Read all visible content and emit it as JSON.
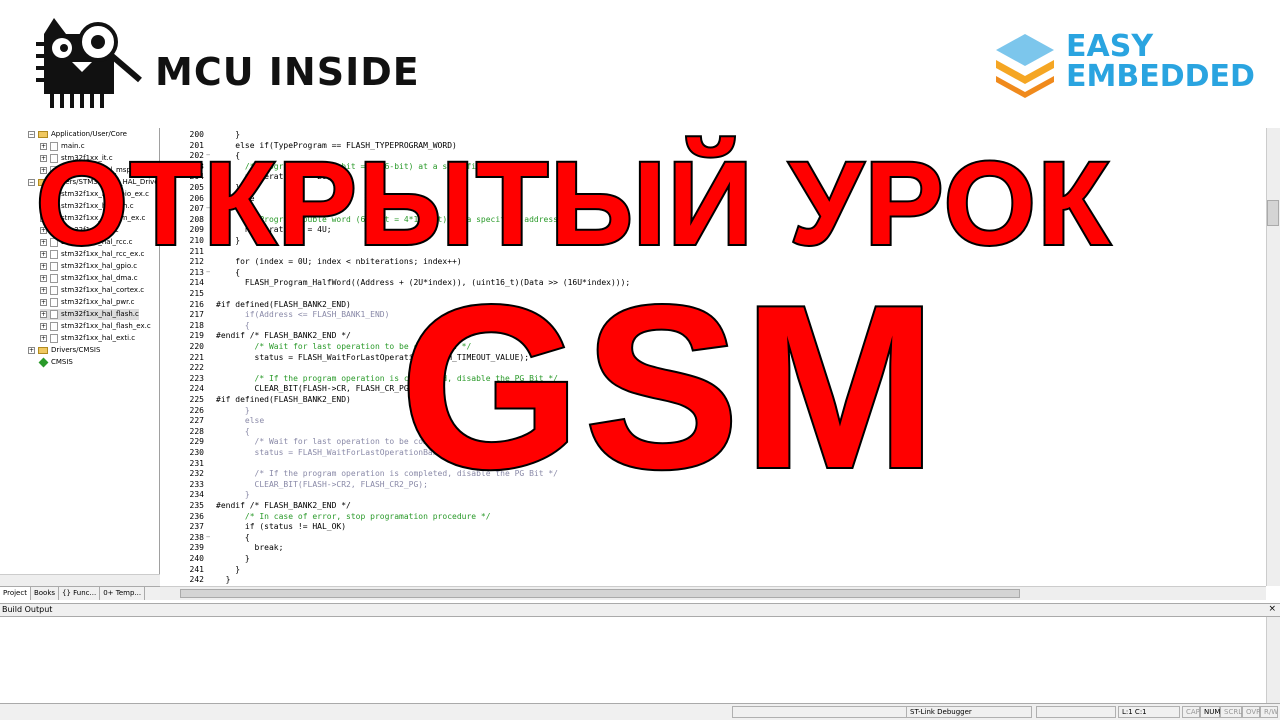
{
  "logos": {
    "left_text": "MCU INSIDE",
    "right_line1": "EASY",
    "right_line2": "EMBEDDED"
  },
  "overlay": {
    "line1": "ОТКРЫТЫЙ УРОК",
    "line2": "GSM"
  },
  "project_tree": [
    {
      "label": "Application/User/Core",
      "kind": "folder",
      "exp": "−"
    },
    {
      "label": "main.c",
      "kind": "file",
      "exp": "+"
    },
    {
      "label": "stm32f1xx_it.c",
      "kind": "file",
      "exp": "+"
    },
    {
      "label": "stm32f1xx_hal_msp.c",
      "kind": "file",
      "exp": "+"
    },
    {
      "label": "Drivers/STM32F1xx_HAL_Driver",
      "kind": "folder",
      "exp": "−"
    },
    {
      "label": "stm32f1xx_hal_gpio_ex.c",
      "kind": "file",
      "exp": "+"
    },
    {
      "label": "stm32f1xx_hal_tim.c",
      "kind": "file",
      "exp": "+"
    },
    {
      "label": "stm32f1xx_hal_tim_ex.c",
      "kind": "file",
      "exp": "+"
    },
    {
      "label": "stm32f1xx_hal.c",
      "kind": "file",
      "exp": "+"
    },
    {
      "label": "stm32f1xx_hal_rcc.c",
      "kind": "file",
      "exp": "+"
    },
    {
      "label": "stm32f1xx_hal_rcc_ex.c",
      "kind": "file",
      "exp": "+"
    },
    {
      "label": "stm32f1xx_hal_gpio.c",
      "kind": "file",
      "exp": "+"
    },
    {
      "label": "stm32f1xx_hal_dma.c",
      "kind": "file",
      "exp": "+"
    },
    {
      "label": "stm32f1xx_hal_cortex.c",
      "kind": "file",
      "exp": "+"
    },
    {
      "label": "stm32f1xx_hal_pwr.c",
      "kind": "file",
      "exp": "+"
    },
    {
      "label": "stm32f1xx_hal_flash.c",
      "kind": "file",
      "exp": "+",
      "selected": true
    },
    {
      "label": "stm32f1xx_hal_flash_ex.c",
      "kind": "file",
      "exp": "+"
    },
    {
      "label": "stm32f1xx_hal_exti.c",
      "kind": "file",
      "exp": "+"
    },
    {
      "label": "Drivers/CMSIS",
      "kind": "folder",
      "exp": "+"
    },
    {
      "label": "CMSIS",
      "kind": "diamond",
      "exp": ""
    }
  ],
  "left_tabs": [
    "Project",
    "Books",
    "{} Func...",
    "0+ Temp..."
  ],
  "code_lines": [
    {
      "n": "200",
      "fold": "",
      "text": "    }",
      "style": ""
    },
    {
      "n": "201",
      "fold": "",
      "text": "    else if(TypeProgram == FLASH_TYPEPROGRAM_WORD)",
      "style": ""
    },
    {
      "n": "202",
      "fold": "−",
      "text": "    {",
      "style": ""
    },
    {
      "n": "203",
      "fold": "",
      "text": "      /* Program word (32-bit = 2*16-bit) at a specified address. */",
      "style": "comment"
    },
    {
      "n": "204",
      "fold": "",
      "text": "      nbiterations = 2U;",
      "style": ""
    },
    {
      "n": "205",
      "fold": "",
      "text": "    }",
      "style": ""
    },
    {
      "n": "206",
      "fold": "",
      "text": "    else",
      "style": ""
    },
    {
      "n": "207",
      "fold": "−",
      "text": "    {",
      "style": ""
    },
    {
      "n": "208",
      "fold": "",
      "text": "      /* Program double word (64-bit = 4*16-bit) at a specified address. */",
      "style": "comment"
    },
    {
      "n": "209",
      "fold": "",
      "text": "      nbiterations = 4U;",
      "style": ""
    },
    {
      "n": "210",
      "fold": "",
      "text": "    }",
      "style": ""
    },
    {
      "n": "211",
      "fold": "",
      "text": "",
      "style": ""
    },
    {
      "n": "212",
      "fold": "",
      "text": "    for (index = 0U; index < nbiterations; index++)",
      "style": ""
    },
    {
      "n": "213",
      "fold": "−",
      "text": "    {",
      "style": ""
    },
    {
      "n": "214",
      "fold": "",
      "text": "      FLASH_Program_HalfWord((Address + (2U*index)), (uint16_t)(Data >> (16U*index)));",
      "style": ""
    },
    {
      "n": "215",
      "fold": "",
      "text": "",
      "style": ""
    },
    {
      "n": "216",
      "fold": "",
      "text": "#if defined(FLASH_BANK2_END)",
      "style": "pre"
    },
    {
      "n": "217",
      "fold": "",
      "text": "      if(Address <= FLASH_BANK1_END)",
      "style": "grey"
    },
    {
      "n": "218",
      "fold": "",
      "text": "      {",
      "style": "grey"
    },
    {
      "n": "219",
      "fold": "",
      "text": "#endif /* FLASH_BANK2_END */",
      "style": "pre"
    },
    {
      "n": "220",
      "fold": "",
      "text": "        /* Wait for last operation to be completed */",
      "style": "comment"
    },
    {
      "n": "221",
      "fold": "",
      "text": "        status = FLASH_WaitForLastOperation(FLASH_TIMEOUT_VALUE);",
      "style": ""
    },
    {
      "n": "222",
      "fold": "",
      "text": "",
      "style": ""
    },
    {
      "n": "223",
      "fold": "",
      "text": "        /* If the program operation is completed, disable the PG Bit */",
      "style": "comment"
    },
    {
      "n": "224",
      "fold": "",
      "text": "        CLEAR_BIT(FLASH->CR, FLASH_CR_PG);",
      "style": ""
    },
    {
      "n": "225",
      "fold": "",
      "text": "#if defined(FLASH_BANK2_END)",
      "style": "pre"
    },
    {
      "n": "226",
      "fold": "",
      "text": "      }",
      "style": "grey"
    },
    {
      "n": "227",
      "fold": "",
      "text": "      else",
      "style": "grey"
    },
    {
      "n": "228",
      "fold": "",
      "text": "      {",
      "style": "grey"
    },
    {
      "n": "229",
      "fold": "",
      "text": "        /* Wait for last operation to be completed */",
      "style": "grey"
    },
    {
      "n": "230",
      "fold": "",
      "text": "        status = FLASH_WaitForLastOperationBank2(FLASH_TIMEOUT_VALUE);",
      "style": "grey"
    },
    {
      "n": "231",
      "fold": "",
      "text": "",
      "style": ""
    },
    {
      "n": "232",
      "fold": "",
      "text": "        /* If the program operation is completed, disable the PG Bit */",
      "style": "grey"
    },
    {
      "n": "233",
      "fold": "",
      "text": "        CLEAR_BIT(FLASH->CR2, FLASH_CR2_PG);",
      "style": "grey"
    },
    {
      "n": "234",
      "fold": "",
      "text": "      }",
      "style": "grey"
    },
    {
      "n": "235",
      "fold": "",
      "text": "#endif /* FLASH_BANK2_END */",
      "style": "pre"
    },
    {
      "n": "236",
      "fold": "",
      "text": "      /* In case of error, stop programation procedure */",
      "style": "comment"
    },
    {
      "n": "237",
      "fold": "",
      "text": "      if (status != HAL_OK)",
      "style": ""
    },
    {
      "n": "238",
      "fold": "−",
      "text": "      {",
      "style": ""
    },
    {
      "n": "239",
      "fold": "",
      "text": "        break;",
      "style": ""
    },
    {
      "n": "240",
      "fold": "",
      "text": "      }",
      "style": ""
    },
    {
      "n": "241",
      "fold": "",
      "text": "    }",
      "style": ""
    },
    {
      "n": "242",
      "fold": "",
      "text": "  }",
      "style": ""
    }
  ],
  "build_output": {
    "title": "Build Output",
    "close": "× "
  },
  "status_bar": {
    "debugger": "ST-Link Debugger",
    "position": "L:1 C:1",
    "cap": "CAP",
    "num": "NUM",
    "scrl": "SCRL",
    "ovr": "OVR",
    "rw": "R/W"
  }
}
